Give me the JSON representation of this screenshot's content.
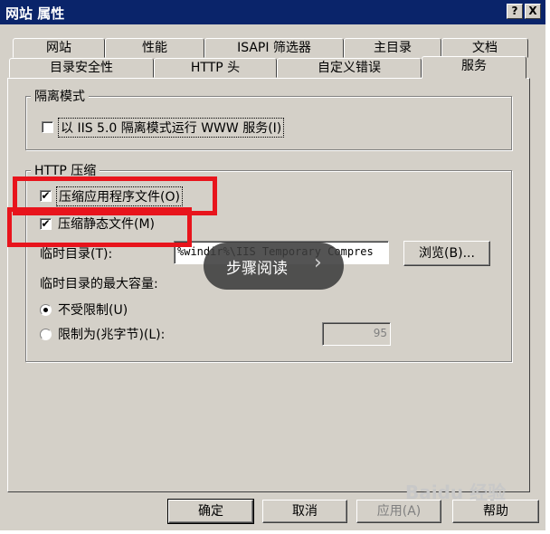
{
  "window": {
    "title": "网站 属性",
    "help_button": "?",
    "close_button": "X"
  },
  "tabs_back": [
    "网站",
    "性能",
    "ISAPI 筛选器",
    "主目录",
    "文档"
  ],
  "tabs_front": [
    "目录安全性",
    "HTTP 头",
    "自定义错误",
    "服务"
  ],
  "isolation": {
    "legend": "隔离模式",
    "checkbox_label": "以 IIS 5.0 隔离模式运行 WWW 服务(I)",
    "checked": false
  },
  "compression": {
    "legend": "HTTP 压缩",
    "app_files_label": "压缩应用程序文件(O)",
    "app_files_checked": true,
    "static_files_label": "压缩静态文件(M)",
    "static_files_checked": true,
    "temp_dir_label": "临时目录(T):",
    "temp_dir_value": "%windir%\\IIS Temporary Compres",
    "browse_label": "浏览(B)...",
    "max_size_label": "临时目录的最大容量:",
    "unlimited_label": "不受限制(U)",
    "limit_label": "限制为(兆字节)(L):",
    "limit_value": "95",
    "selected_option": "unlimited"
  },
  "buttons": {
    "ok": "确定",
    "cancel": "取消",
    "apply": "应用(A)",
    "help": "帮助"
  },
  "overlay": {
    "text": "步骤阅读",
    "arrow": "›"
  },
  "watermark": {
    "text": "Baidu 经验"
  }
}
